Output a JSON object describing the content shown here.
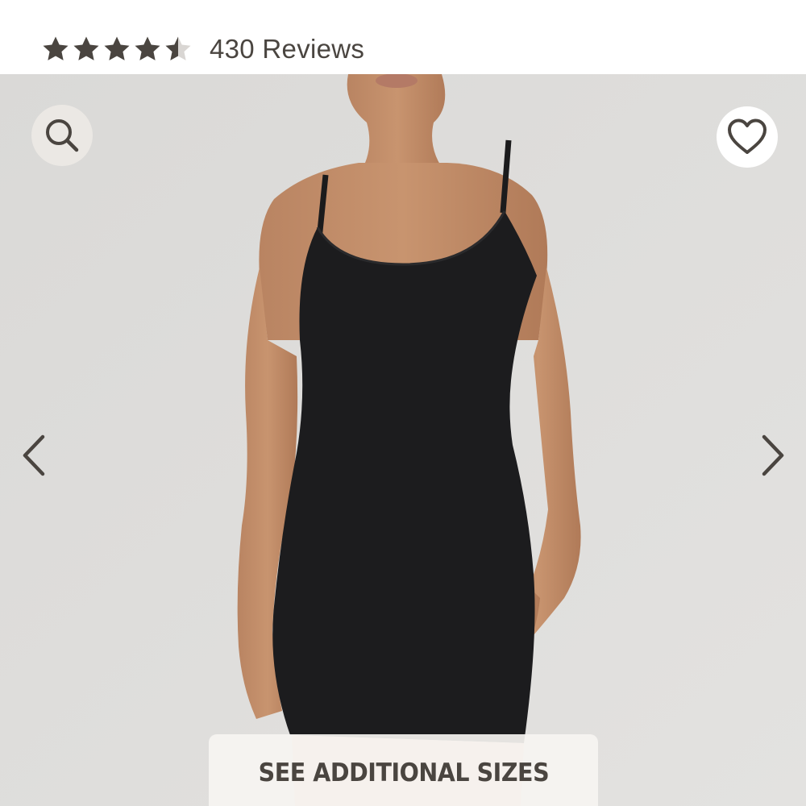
{
  "rating": {
    "stars_value": 4.5,
    "stars_max": 5,
    "reviews_label": "430 Reviews",
    "star_color": "#4a4540",
    "star_empty_color": "#d9d6d3"
  },
  "gallery": {
    "image_description_icon": "product-photo",
    "search_icon": "search-icon",
    "favorite_icon": "heart-icon",
    "prev_icon": "chevron-left-icon",
    "next_icon": "chevron-right-icon",
    "see_sizes_label": "SEE ADDITIONAL SIZES",
    "accent_color": "#4a4540",
    "background_color": "#dcdbd9"
  }
}
